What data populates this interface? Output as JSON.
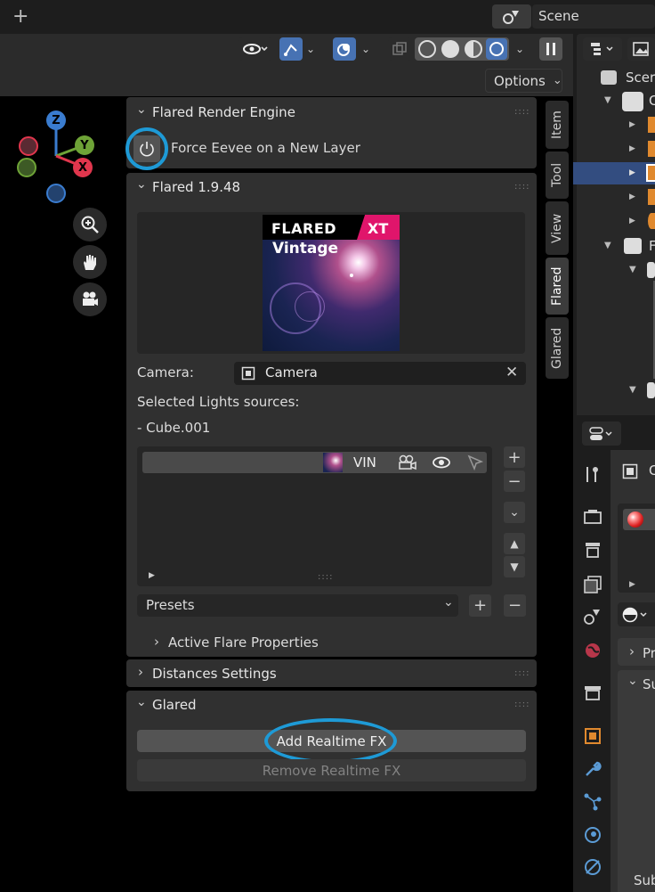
{
  "topbar": {
    "add_label": "+",
    "scene_label": "Scene"
  },
  "viewport_header": {
    "options_label": "Options"
  },
  "gizmo": {
    "z_label": "Z",
    "y_label": "Y",
    "x_label": "X"
  },
  "tabs": [
    "Item",
    "Tool",
    "View",
    "Flared",
    "Glared"
  ],
  "panels": {
    "render_engine": {
      "title": "Flared Render Engine",
      "force_eevee_label": "Force Eevee on a New Layer"
    },
    "flared": {
      "title": "Flared 1.9.48",
      "thumb_title": "FLARED",
      "thumb_badge": "XT",
      "thumb_subtitle": "Vintage",
      "camera_label": "Camera:",
      "camera_value": "Camera",
      "selected_lights_label": "Selected Lights sources:",
      "selected_light_item": "- Cube.001",
      "list_item_label": "VIN",
      "presets_label": "Presets",
      "active_flare_props": "Active Flare Properties"
    },
    "distances": {
      "title": "Distances Settings"
    },
    "glared": {
      "title": "Glared",
      "add_fx_label": "Add Realtime FX",
      "remove_fx_label": "Remove Realtime FX"
    }
  },
  "outliner": {
    "root_label": "Scer",
    "cropped_a": "C",
    "cropped_b": "F"
  },
  "properties": {
    "cropped_c": "C",
    "cropped_pr": "Pr",
    "cropped_su": "Su",
    "cropped_sub": "Sub"
  },
  "colors": {
    "highlight": "#1e9ad6",
    "axis_z": "#3a7ccf",
    "axis_y": "#6ea337",
    "axis_x": "#e0364d",
    "accent_pink": "#e0156b"
  }
}
